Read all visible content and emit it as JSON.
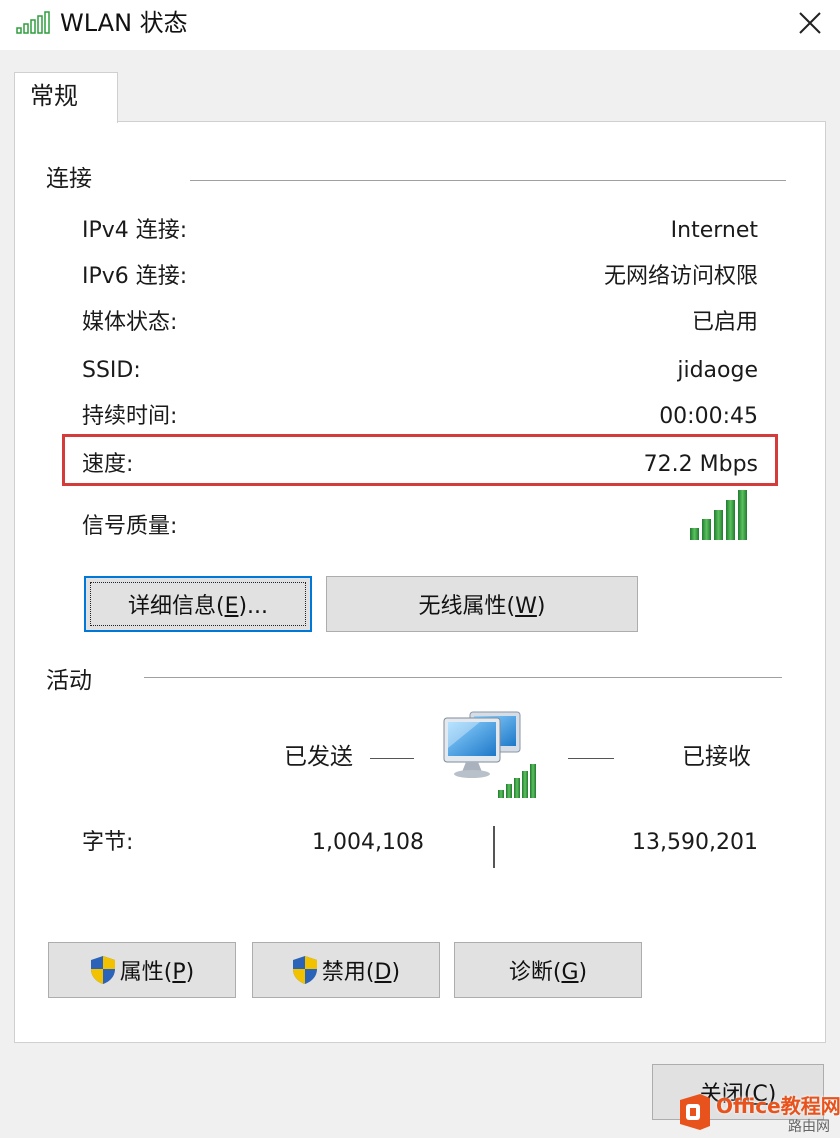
{
  "window": {
    "title": "WLAN 状态",
    "close_glyph": "✕"
  },
  "tabs": [
    {
      "label": "常规"
    }
  ],
  "connection": {
    "group_title": "连接",
    "rows": [
      {
        "label": "IPv4 连接:",
        "value": "Internet"
      },
      {
        "label": "IPv6 连接:",
        "value": "无网络访问权限"
      },
      {
        "label": "媒体状态:",
        "value": "已启用"
      },
      {
        "label": "SSID:",
        "value": "jidaoge"
      },
      {
        "label": "持续时间:",
        "value": "00:00:45"
      },
      {
        "label": "速度:",
        "value": "72.2 Mbps"
      }
    ],
    "signal_label": "信号质量:",
    "signal_bars": 5,
    "signal_bars_total": 5,
    "signal_icon": "signal-strength-icon",
    "highlight_color": "#d43b3b"
  },
  "buttons": {
    "details": {
      "pre": "详细信息(",
      "key": "E",
      "post": ")..."
    },
    "wireless": {
      "pre": "无线属性(",
      "key": "W",
      "post": ")"
    },
    "properties": {
      "pre": "属性(",
      "key": "P",
      "post": ")"
    },
    "disable": {
      "pre": "禁用(",
      "key": "D",
      "post": ")"
    },
    "diagnose": {
      "pre": "诊断(",
      "key": "G",
      "post": ")"
    },
    "close": {
      "pre": "关闭(",
      "key": "C",
      "post": ")"
    }
  },
  "activity": {
    "group_title": "活动",
    "sent_label": "已发送",
    "received_label": "已接收",
    "bytes_label": "字节:",
    "bytes_sent": "1,004,108",
    "bytes_received": "13,590,201",
    "network_icon": "network-computer-icon"
  },
  "watermark": {
    "text": "Office教程网",
    "sub": "路由网",
    "brand_color": "#e8531d"
  },
  "colors": {
    "focus_blue": "#0078d7",
    "signal_green": "#2e9e3e",
    "shield_blue": "#2a63b7",
    "shield_yellow": "#f2c200"
  }
}
